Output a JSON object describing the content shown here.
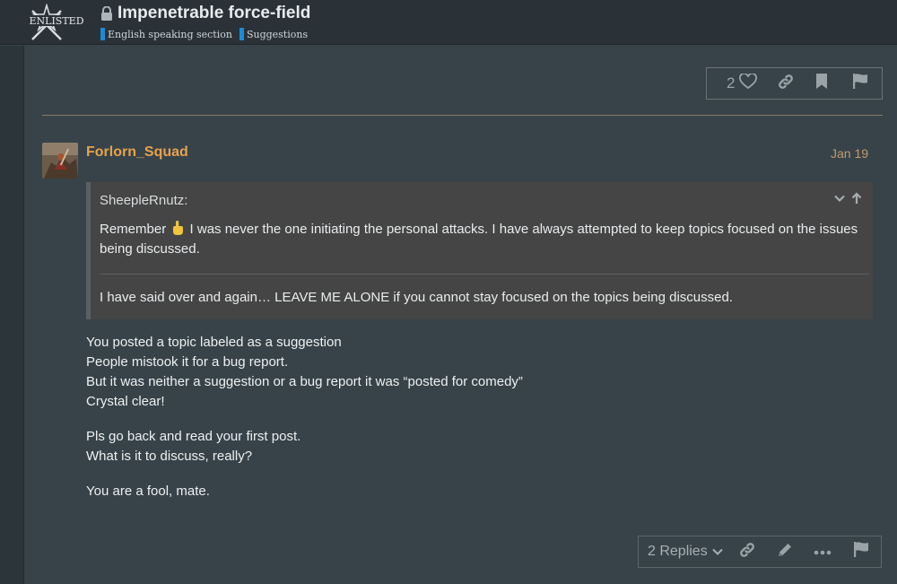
{
  "header": {
    "logo_text": "ENLISTED",
    "title": "Impenetrable force-field",
    "categories": [
      {
        "label": "English speaking section",
        "color": "#1b8bd6"
      },
      {
        "label": "Suggestions",
        "color": "#1b8bd6"
      }
    ]
  },
  "top_actions": {
    "like_count": "2",
    "icons": [
      "heart-icon",
      "link-icon",
      "bookmark-icon",
      "flag-icon"
    ]
  },
  "post": {
    "username": "Forlorn_Squad",
    "date": "Jan 19",
    "quote": {
      "author": "SheepleRnutz:",
      "p1_before": "Remember",
      "p1_after": "I was never the one initiating the personal attacks. I have always attempted to keep topics focused on the issues being discussed.",
      "p2": "I have said over and again… LEAVE ME ALONE if you cannot stay focused on the topics being discussed."
    },
    "paragraphs": [
      {
        "lines": [
          "You posted a topic labeled as a suggestion",
          "People mistook it for a bug report.",
          "But it was neither a suggestion or a bug report it was “posted for comedy”",
          "Crystal clear!"
        ]
      },
      {
        "lines": [
          "Pls go back and read your first post.",
          "What is it to discuss, really?"
        ]
      },
      {
        "lines": [
          "You are a fool, mate."
        ]
      }
    ]
  },
  "bottom_actions": {
    "replies_label": "2 Replies",
    "icons": [
      "link-icon",
      "edit-icon",
      "more-icon",
      "flag-icon"
    ]
  },
  "colors": {
    "accent": "#e7a24c",
    "background": "#374349",
    "header": "#2a3237"
  }
}
